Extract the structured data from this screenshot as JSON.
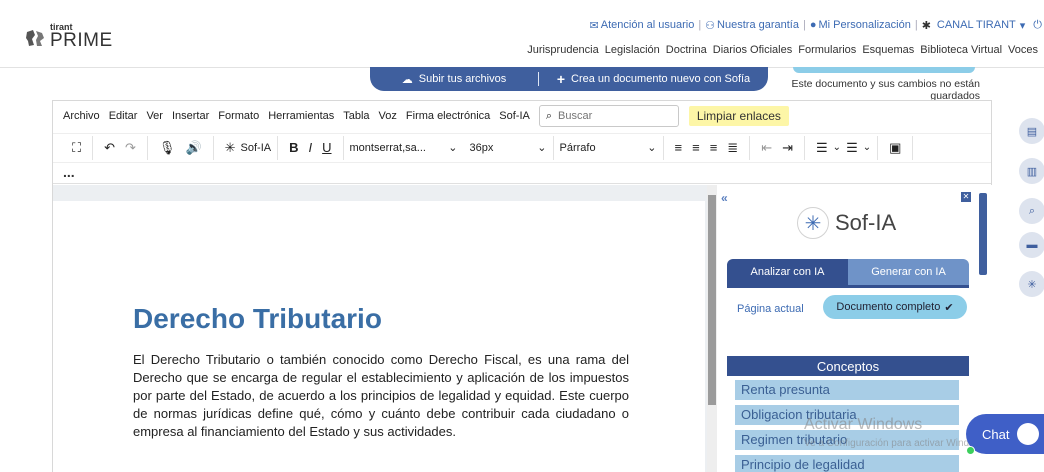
{
  "brand": {
    "small": "tirant",
    "big": "PRIME"
  },
  "toplinks": {
    "support": "Atención al usuario",
    "guarantee": "Nuestra garantía",
    "personalization": "Mi Personalización",
    "channel": "CANAL TIRANT"
  },
  "mainnav": [
    "Jurisprudencia",
    "Legislación",
    "Doctrina",
    "Diarios Oficiales",
    "Formularios",
    "Esquemas",
    "Biblioteca Virtual",
    "Voces"
  ],
  "actions": {
    "upload": "Subir tus archivos",
    "create": "Crea un documento nuevo con Sofía",
    "save_note": "Este documento y sus cambios no están guardados"
  },
  "menubar": [
    "Archivo",
    "Editar",
    "Ver",
    "Insertar",
    "Formato",
    "Herramientas",
    "Tabla",
    "Voz",
    "Firma electrónica",
    "Sof-IA"
  ],
  "search": {
    "placeholder": "Buscar"
  },
  "clear_links": "Limpiar enlaces",
  "toolbar": {
    "sofia": "Sof-IA",
    "bold": "B",
    "italic": "I",
    "underline": "U",
    "font": "montserrat,sa...",
    "size": "36px",
    "paragraph": "Párrafo",
    "more": "..."
  },
  "document": {
    "title": "Derecho Tributario",
    "body": "El Derecho Tributario o también conocido como Derecho Fiscal, es una rama del Derecho que se encarga de regular el establecimiento y aplicación de los impuestos por parte del Estado, de acuerdo a los principios de legalidad y equidad. Este cuerpo de normas jurídicas define qué, cómo y cuánto debe contribuir cada ciudadano o empresa al financiamiento del Estado y sus actividades."
  },
  "panel": {
    "name": "Sof-IA",
    "tab_analyze": "Analizar con IA",
    "tab_generate": "Generar con IA",
    "scope_current": "Página actual",
    "scope_full": "Documento completo",
    "concepts_title": "Conceptos",
    "concepts": [
      "Renta presunta",
      "Obligacion tributaria",
      "Regimen tributario",
      "Principio de legalidad"
    ]
  },
  "watermark": {
    "line1": "Activar Windows",
    "line2": "Ve a Configuración para activar Windows."
  },
  "chat": {
    "label": "Chat"
  },
  "colors": {
    "primary": "#3f5f9e",
    "accent": "#8ccde8",
    "highlight": "#fdf6a7",
    "title": "#3a6ea5"
  }
}
